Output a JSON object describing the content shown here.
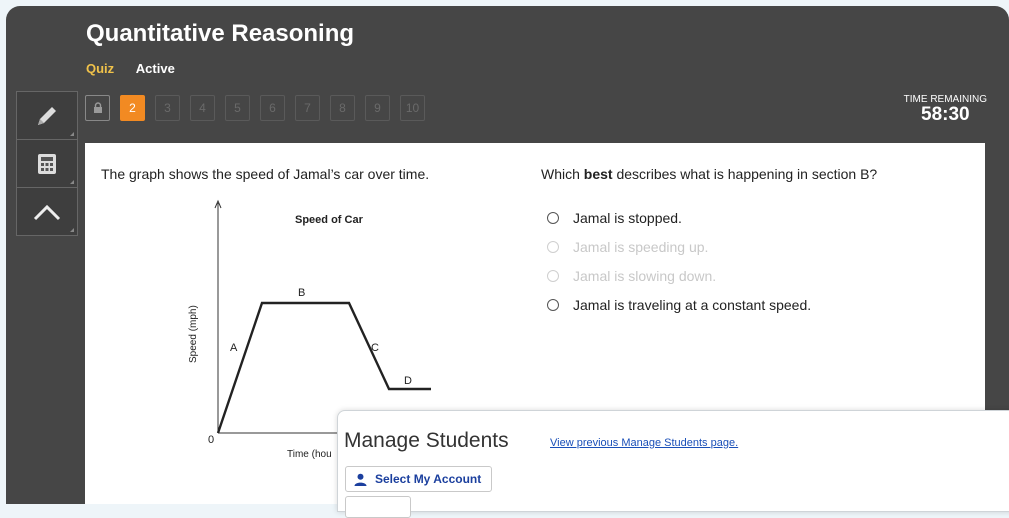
{
  "header": {
    "title": "Quantitative Reasoning",
    "mode": "Quiz",
    "status": "Active"
  },
  "toolbar": {
    "tools": [
      "pencil-icon",
      "calculator-icon",
      "line-tool-icon"
    ]
  },
  "question_nav": {
    "buttons": [
      "2",
      "3",
      "4",
      "5",
      "6",
      "7",
      "8",
      "9",
      "10"
    ],
    "current": "2"
  },
  "timer": {
    "label": "TIME REMAINING",
    "value": "58:30"
  },
  "question": {
    "prompt": "The graph shows the speed of Jamal’s car over time.",
    "ask_pre": "Which ",
    "ask_bold": "best",
    "ask_post": " describes what is happening in section B?",
    "options": [
      {
        "text": "Jamal is stopped.",
        "disabled": false
      },
      {
        "text": "Jamal is speeding up.",
        "disabled": true
      },
      {
        "text": "Jamal is slowing down.",
        "disabled": true
      },
      {
        "text": "Jamal is traveling at a constant speed.",
        "disabled": false
      }
    ]
  },
  "graph": {
    "title": "Speed of Car",
    "ylabel": "Speed (mph)",
    "xlabel": "Time (hou",
    "origin_label": "0",
    "section_labels": [
      "A",
      "B",
      "C",
      "D"
    ]
  },
  "manage_panel": {
    "title": "Manage Students",
    "link": "View previous Manage Students page.",
    "button": "Select My Account"
  }
}
